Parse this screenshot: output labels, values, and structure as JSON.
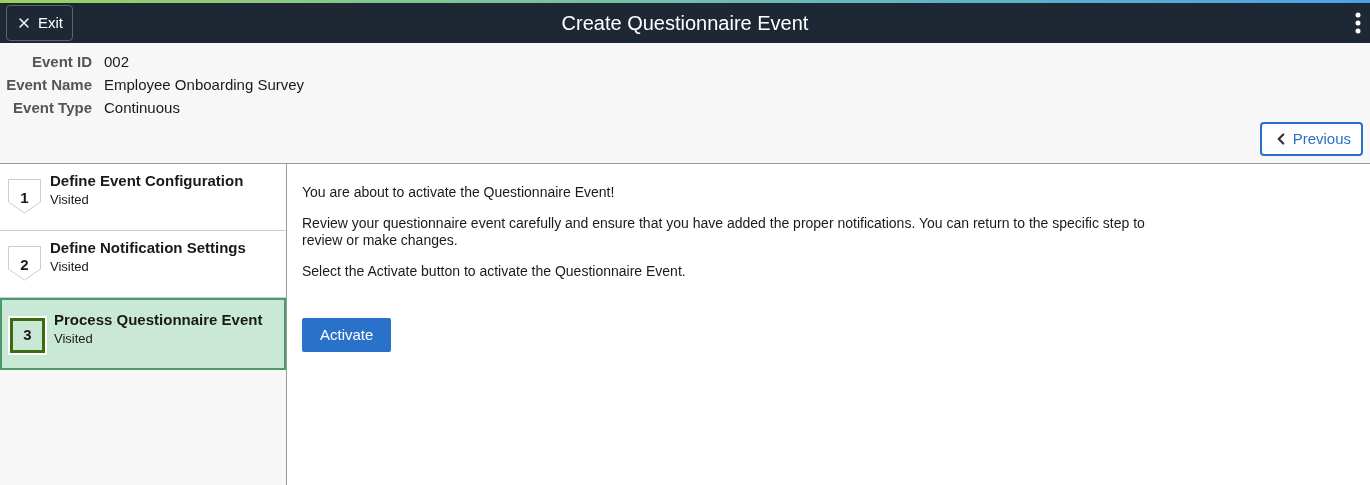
{
  "header": {
    "exit_label": "Exit",
    "title": "Create Questionnaire Event"
  },
  "fields": [
    {
      "label": "Event ID",
      "value": "002"
    },
    {
      "label": "Event Name",
      "value": "Employee Onboarding Survey"
    },
    {
      "label": "Event Type",
      "value": "Continuous"
    }
  ],
  "previous_label": "Previous",
  "steps": [
    {
      "number": "1",
      "title": "Define Event Configuration",
      "status": "Visited",
      "selected": false
    },
    {
      "number": "2",
      "title": "Define Notification Settings",
      "status": "Visited",
      "selected": false
    },
    {
      "number": "3",
      "title": "Process Questionnaire Event",
      "status": "Visited",
      "selected": true
    }
  ],
  "paragraphs": [
    "You are about to activate the Questionnaire Event!",
    "Review your questionnaire event carefully and ensure that you have added the proper notifications. You can return to the specific step to review or make changes.",
    "Select the Activate button to activate the Questionnaire Event."
  ],
  "activate_label": "Activate"
}
